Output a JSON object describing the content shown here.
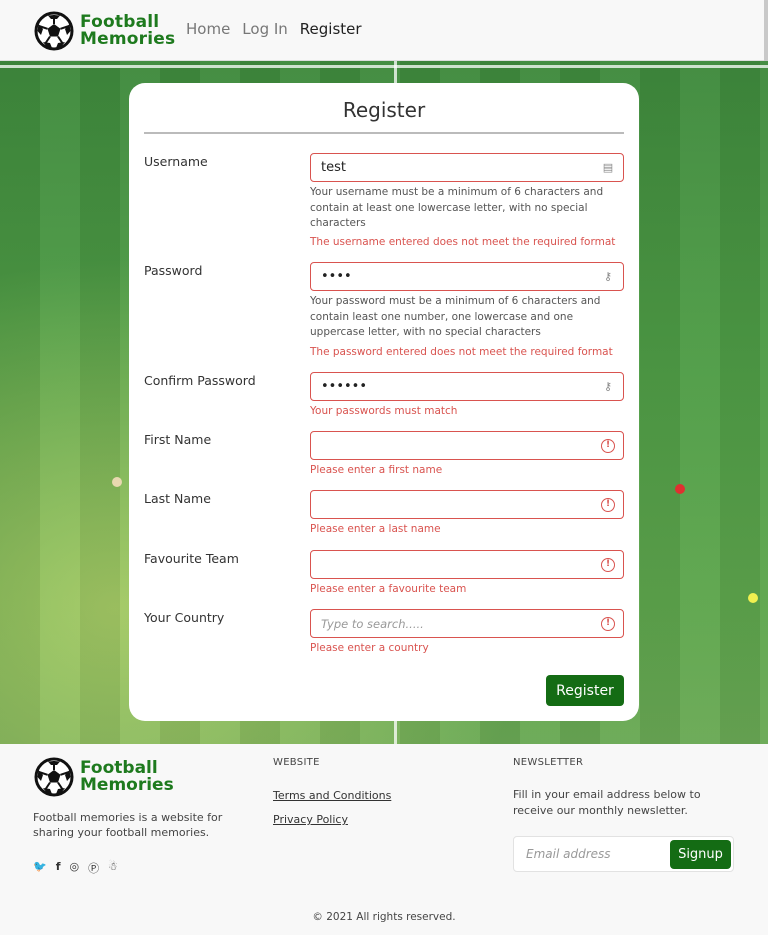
{
  "brand": {
    "line1": "Football",
    "line2": "Memories",
    "color": "#1e7a1e"
  },
  "nav": {
    "home": "Home",
    "login": "Log In",
    "register": "Register"
  },
  "form": {
    "title": "Register",
    "username": {
      "label": "Username",
      "value": "test",
      "help": "Your username must be a minimum of 6 characters and contain at least one lowercase letter, with no special characters",
      "error": "The username entered does not meet the required format"
    },
    "password": {
      "label": "Password",
      "value": "••••",
      "help": "Your password must be a minimum of 6 characters and contain least one number, one lowercase and one uppercase letter, with no special characters",
      "error": "The password entered does not meet the required format"
    },
    "confirm_password": {
      "label": "Confirm Password",
      "value": "••••••",
      "error": "Your passwords must match"
    },
    "first_name": {
      "label": "First Name",
      "value": "",
      "error": "Please enter a first name"
    },
    "last_name": {
      "label": "Last Name",
      "value": "",
      "error": "Please enter a last name"
    },
    "favourite_team": {
      "label": "Favourite Team",
      "value": "",
      "error": "Please enter a favourite team"
    },
    "country": {
      "label": "Your Country",
      "placeholder": "Type to search.....",
      "error": "Please enter a country"
    },
    "submit_label": "Register",
    "error_color": "#d9534f",
    "accent_color": "#146c14"
  },
  "footer": {
    "description": "Football memories is a website for sharing your football memories.",
    "socials": [
      "twitter-icon",
      "facebook-icon",
      "instagram-icon",
      "pinterest-icon",
      "snapchat-icon"
    ],
    "website_heading": "WEBSITE",
    "links": [
      "Terms and Conditions",
      "Privacy Policy"
    ],
    "newsletter_heading": "NEWSLETTER",
    "newsletter_text": "Fill in your email address below to receive our monthly newsletter.",
    "email_placeholder": "Email address",
    "signup_label": "Signup",
    "copyright": "© 2021 All rights reserved."
  }
}
